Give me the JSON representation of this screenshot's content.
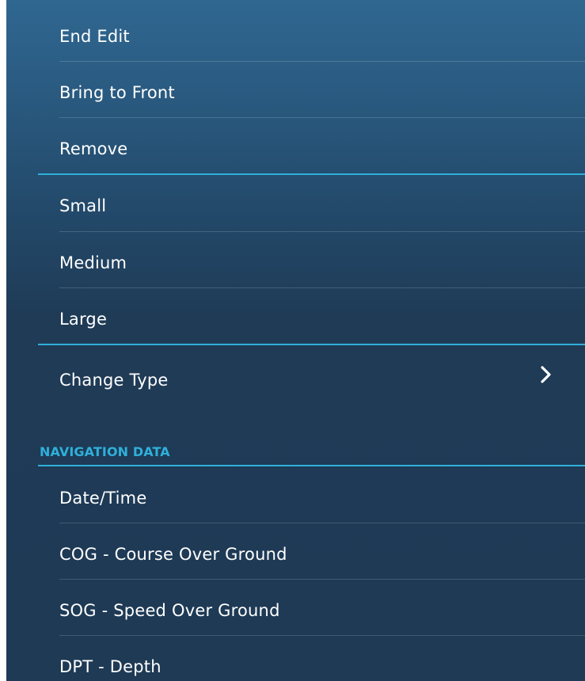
{
  "menu": {
    "actions": [
      {
        "label": "End Edit"
      },
      {
        "label": "Bring to Front"
      },
      {
        "label": "Remove"
      }
    ],
    "sizes": [
      {
        "label": "Small"
      },
      {
        "label": "Medium"
      },
      {
        "label": "Large"
      }
    ],
    "change_type": {
      "label": "Change Type",
      "icon": "chevron-right-icon"
    }
  },
  "navigation_data": {
    "header": "NAVIGATION DATA",
    "items": [
      {
        "label": "Date/Time"
      },
      {
        "label": "COG - Course Over Ground"
      },
      {
        "label": "SOG - Speed Over Ground"
      },
      {
        "label": "DPT - Depth"
      }
    ]
  },
  "colors": {
    "accent": "#2fb0da",
    "panel_top": "#2f6791",
    "panel_bottom": "#1e3a55",
    "text": "#ffffff"
  }
}
